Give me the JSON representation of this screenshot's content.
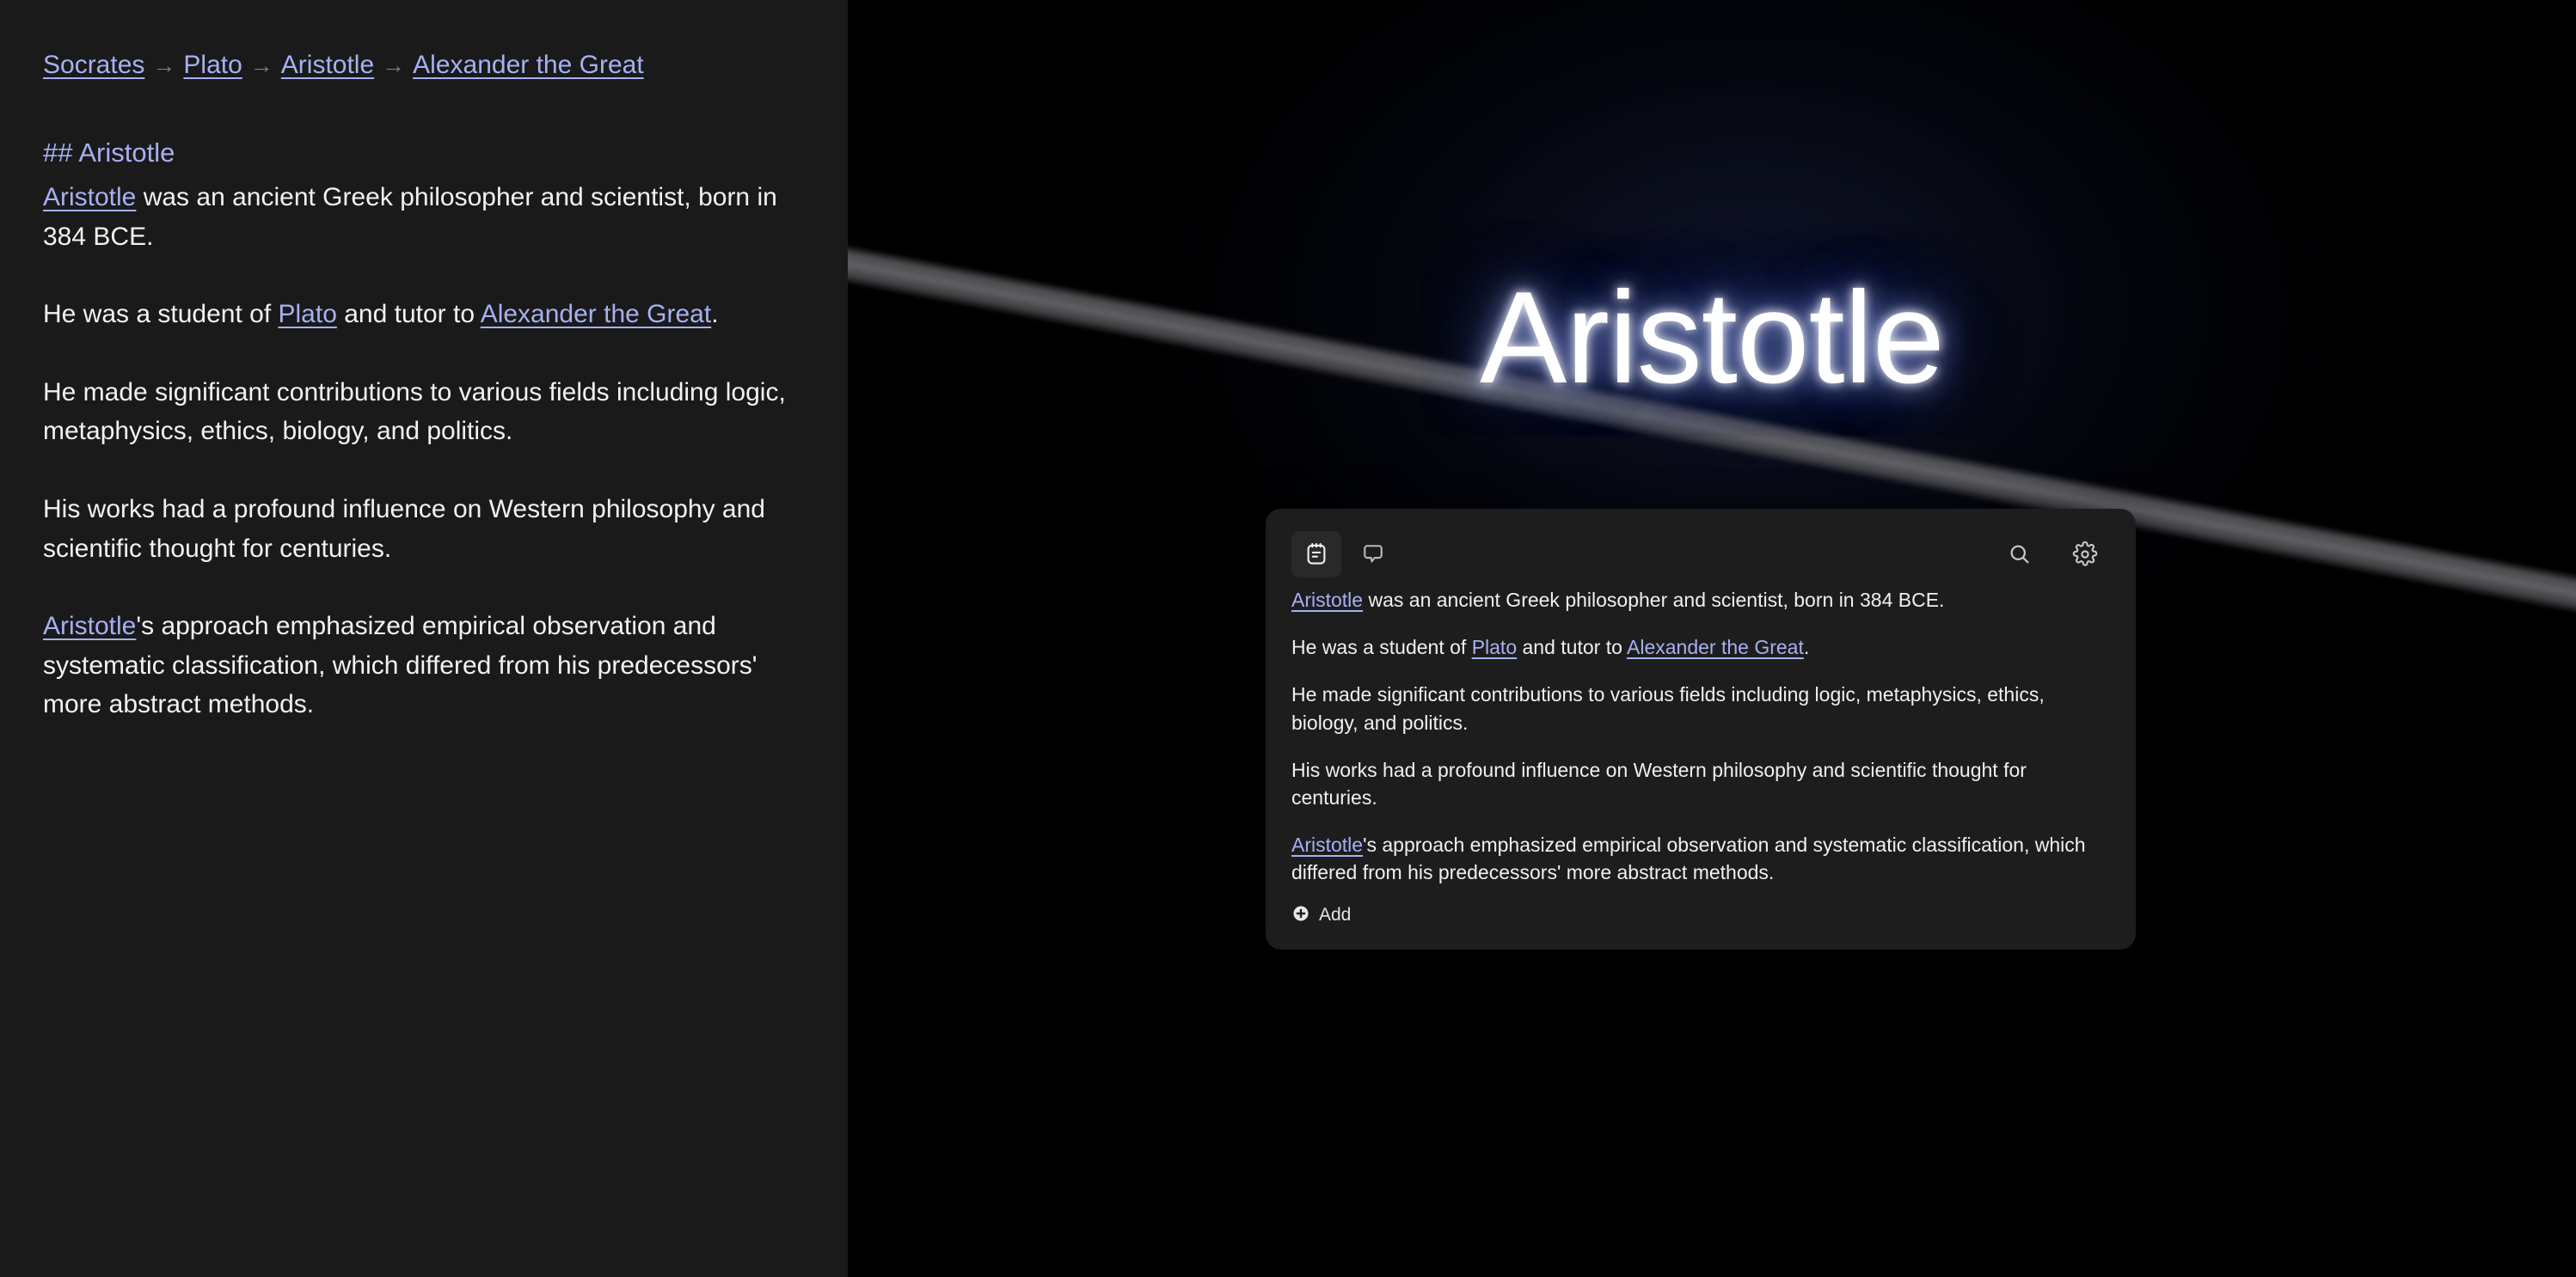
{
  "breadcrumb": {
    "separator": "→",
    "items": [
      {
        "label": "Socrates"
      },
      {
        "label": "Plato"
      },
      {
        "label": "Aristotle"
      },
      {
        "label": "Alexander the Great"
      }
    ]
  },
  "document": {
    "heading": "## Aristotle",
    "paragraphs": [
      {
        "id": "p1",
        "segments": [
          {
            "type": "link",
            "text": "Aristotle"
          },
          {
            "type": "text",
            "text": " was an ancient Greek philosopher and scientist, born in 384 BCE."
          }
        ]
      },
      {
        "id": "p2",
        "segments": [
          {
            "type": "text",
            "text": "He was a student of "
          },
          {
            "type": "link",
            "text": "Plato"
          },
          {
            "type": "text",
            "text": " and tutor to "
          },
          {
            "type": "link",
            "text": "Alexander the Great"
          },
          {
            "type": "text",
            "text": "."
          }
        ]
      },
      {
        "id": "p3",
        "segments": [
          {
            "type": "text",
            "text": "He made significant contributions to various fields including logic, metaphysics, ethics, biology, and politics."
          }
        ]
      },
      {
        "id": "p4",
        "segments": [
          {
            "type": "text",
            "text": "His works had a profound influence on Western philosophy and scientific thought for centuries."
          }
        ]
      },
      {
        "id": "p5",
        "segments": [
          {
            "type": "link",
            "text": "Aristotle"
          },
          {
            "type": "text",
            "text": "'s approach emphasized empirical observation and systematic classification, which differed from his predecessors' more abstract methods."
          }
        ]
      }
    ]
  },
  "stage": {
    "hero_title": "Aristotle"
  },
  "card": {
    "toolbar": {
      "left_icons": [
        {
          "name": "notes-icon",
          "active": true
        },
        {
          "name": "comment-icon",
          "active": false
        }
      ],
      "right_icons": [
        {
          "name": "search-icon"
        },
        {
          "name": "gear-icon"
        }
      ]
    },
    "paragraphs": [
      {
        "id": "c1",
        "segments": [
          {
            "type": "link",
            "text": "Aristotle"
          },
          {
            "type": "text",
            "text": " was an ancient Greek philosopher and scientist, born in 384 BCE."
          }
        ]
      },
      {
        "id": "c2",
        "segments": [
          {
            "type": "text",
            "text": "He was a student of "
          },
          {
            "type": "link",
            "text": "Plato"
          },
          {
            "type": "text",
            "text": " and tutor to "
          },
          {
            "type": "link",
            "text": "Alexander the Great"
          },
          {
            "type": "text",
            "text": "."
          }
        ]
      },
      {
        "id": "c3",
        "segments": [
          {
            "type": "text",
            "text": "He made significant contributions to various fields including logic, metaphysics, ethics, biology, and politics."
          }
        ]
      },
      {
        "id": "c4",
        "segments": [
          {
            "type": "text",
            "text": "His works had a profound influence on Western philosophy and scientific thought for centuries."
          }
        ]
      },
      {
        "id": "c5",
        "segments": [
          {
            "type": "link",
            "text": "Aristotle"
          },
          {
            "type": "text",
            "text": "'s approach emphasized empirical observation and systematic classification, which differed from his predecessors' more abstract methods."
          }
        ]
      }
    ],
    "add_button": {
      "label": "Add",
      "icon": "plus-circle-icon"
    }
  },
  "colors": {
    "link": "#a8b0f2",
    "left_panel_bg": "#1a1a1a",
    "stage_bg": "#000000",
    "card_bg": "#1d1d1d",
    "body_text": "#f2f2f2",
    "breadcrumb_arrow": "#7e7e86",
    "hero_glow": "#8ea0ff",
    "diagonal_band": "#686a6e"
  }
}
